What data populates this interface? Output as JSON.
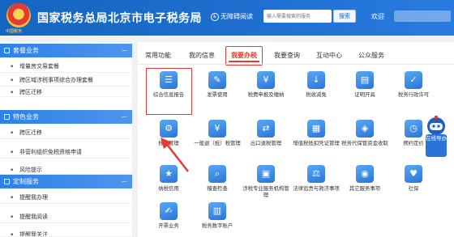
{
  "header": {
    "emblem_caption": "中国税务",
    "title": "国家税务总局北京市电子税务局",
    "accessible_label": "无障碍阅读",
    "search_placeholder": "输入需要搜索的服务",
    "search_button": "搜索",
    "welcome": "欢迎"
  },
  "sidebar": {
    "groups": [
      {
        "title": "套餐业务",
        "items": [
          "增量房交易套餐",
          "跨区域涉税事项综合办理套餐",
          "跨区迁移"
        ]
      },
      {
        "title": "特色业务",
        "items": [
          "跨区迁移",
          "非营利组织免税资格申请",
          "风险提示"
        ]
      },
      {
        "title": "定制服务",
        "items": [
          "提醒我办理",
          "提醒我阅读",
          "提醒我关注"
        ]
      }
    ]
  },
  "tabs": [
    "常用功能",
    "我的信息",
    "我要办税",
    "我要查询",
    "互动中心",
    "公众服务"
  ],
  "active_tab": "我要办税",
  "functions": [
    {
      "label": "综合信息报告",
      "icon": "document-list-icon",
      "glyph": "☰"
    },
    {
      "label": "发票使用",
      "icon": "invoice-icon",
      "glyph": "✎"
    },
    {
      "label": "税费申报及缴纳",
      "icon": "tax-payment-icon",
      "glyph": "¥"
    },
    {
      "label": "税收减免",
      "icon": "tax-reduction-icon",
      "glyph": "↓"
    },
    {
      "label": "证明开具",
      "icon": "certificate-icon",
      "glyph": "▤"
    },
    {
      "label": "税务行政许可",
      "icon": "license-icon",
      "glyph": "✓"
    },
    {
      "label": "核定管理",
      "icon": "person-gear-icon",
      "glyph": "⚙"
    },
    {
      "label": "一般退（抵）税管理",
      "icon": "tax-refund-icon",
      "glyph": "¥"
    },
    {
      "label": "出口退税管理",
      "icon": "export-refund-icon",
      "glyph": "⇄"
    },
    {
      "label": "增值税抵扣凭证管理",
      "icon": "vat-voucher-icon",
      "glyph": "▦"
    },
    {
      "label": "税务代保管资金收取",
      "icon": "fund-custody-icon",
      "glyph": "◈"
    },
    {
      "label": "预约定价",
      "icon": "pricing-icon",
      "glyph": "◷"
    },
    {
      "label": "纳税信用",
      "icon": "credit-icon",
      "glyph": "★"
    },
    {
      "label": "稽查检查",
      "icon": "inspection-icon",
      "glyph": "⌕"
    },
    {
      "label": "涉税专业服务机构管理",
      "icon": "agency-icon",
      "glyph": "▣"
    },
    {
      "label": "法律追责与救济事项",
      "icon": "legal-icon",
      "glyph": "⚖"
    },
    {
      "label": "其它服务事项",
      "icon": "other-services-icon",
      "glyph": "◉"
    },
    {
      "label": "社保",
      "icon": "social-security-icon",
      "glyph": "♥"
    },
    {
      "label": "开票业务",
      "icon": "invoicing-icon",
      "glyph": "✍"
    },
    {
      "label": "税务数字账户",
      "icon": "digital-account-icon",
      "glyph": "▥"
    }
  ],
  "robot": {
    "label": "在线导办"
  }
}
